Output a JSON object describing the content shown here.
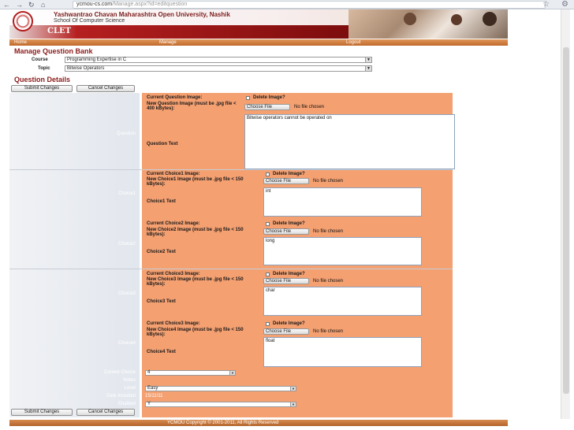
{
  "browser": {
    "url_host": "ycmou-cs.com",
    "url_path": "/Manage.aspx?id=editquestion"
  },
  "header": {
    "university": "Yashwantrao Chavan Maharashtra Open University, Nashik",
    "school": "School Of Computer Science",
    "brand": "CLET"
  },
  "menu": {
    "home": "Home",
    "manage": "Manage",
    "logout": "Logout"
  },
  "manage": {
    "title": "Manage Question Bank",
    "course_label": "Course",
    "course_value": "Programming Expertise in C",
    "topic_label": "Topic",
    "topic_value": "Bitwise Operators"
  },
  "details": {
    "title": "Question Details",
    "submit": "Submit Changes",
    "cancel": "Cancel Changes"
  },
  "question": {
    "side": "Question",
    "current_image": "Current Question Image:",
    "delete_image": "Delete Image?",
    "new_image": "New Question Image (must be .jpg file < 400 kBytes):",
    "choose_file": "Choose File",
    "no_file": "No file chosen",
    "text_label": "Question Text",
    "text_value": "Bitwise operators cannot be operated on"
  },
  "choices": [
    {
      "side": "Choice1",
      "current": "Current Choice1 Image:",
      "delete": "Delete Image?",
      "newimg": "New Choice1 Image (must be .jpg file < 150 kBytes):",
      "choose": "Choose File",
      "nofile": "No file chosen",
      "text_label": "Choice1 Text",
      "text": "int"
    },
    {
      "side": "Choice2",
      "current": "Current Choice2 Image:",
      "delete": "Delete Image?",
      "newimg": "New Choice2 Image (must be .jpg file < 150 kBytes):",
      "choose": "Choose File",
      "nofile": "No file chosen",
      "text_label": "Choice2 Text",
      "text": "long"
    },
    {
      "side": "Choice3",
      "current": "Current Choice3 Image:",
      "delete": "Delete Image?",
      "newimg": "New Choice3 Image (must be .jpg file < 150 kBytes):",
      "choose": "Choose File",
      "nofile": "No file chosen",
      "text_label": "Choice3 Text",
      "text": "char"
    },
    {
      "side": "Choice4",
      "current": "Current Choice3 Image:",
      "delete": "Delete Image?",
      "newimg": "New Choice4 Image (must be .jpg file < 150 kBytes):",
      "choose": "Choose File",
      "nofile": "No file chosen",
      "text_label": "Choice4 Text",
      "text": "float"
    }
  ],
  "extra": {
    "correct_label": "Correct Choice",
    "correct_value": "4",
    "notes_label": "Notes",
    "level_label": "Level",
    "level_value": "Easy",
    "date_label": "Date Included",
    "date_value": "15/11/11",
    "enabled_label": "Enabled",
    "enabled_value": "Y"
  },
  "footer": {
    "copyright": "YCMOU Copyright © 2001-2011, All Rights Reserved"
  },
  "colors": {
    "panel": "#f4a071",
    "title": "#8b1a1a",
    "brand_red": "#b51f1f"
  }
}
